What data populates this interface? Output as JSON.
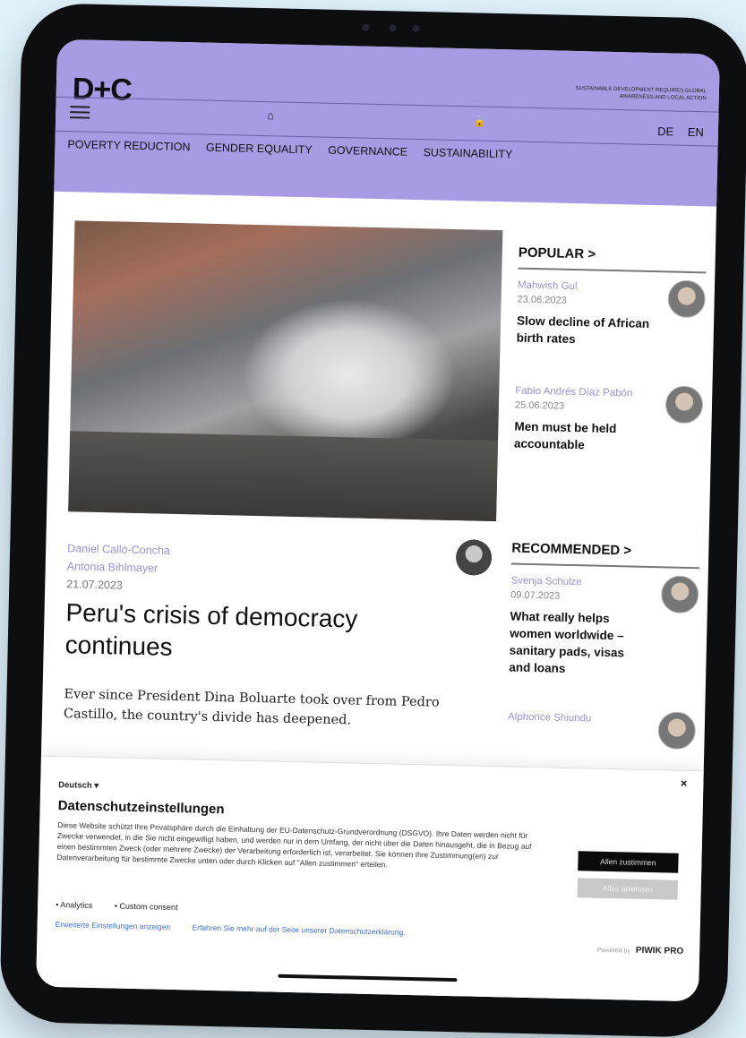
{
  "header": {
    "logo": "D+C",
    "tagline": "SUSTAINABLE DEVELOPMENT REQUIRES GLOBAL AWARENESS AND LOCAL ACTION",
    "languages": [
      "DE",
      "EN"
    ],
    "nav": [
      "POVERTY REDUCTION",
      "GENDER EQUALITY",
      "GOVERNANCE",
      "SUSTAINABILITY"
    ]
  },
  "article": {
    "authors": [
      "Daniel Callo-Concha",
      "Antonia Bihlmayer"
    ],
    "date": "21.07.2023",
    "title": "Peru's crisis of democracy continues",
    "teaser": "Ever since President Dina Boluarte took over from Pedro Castillo, the country's divide has deepened."
  },
  "popular": {
    "heading": "POPULAR >",
    "items": [
      {
        "author": "Mahwish Gul",
        "date": "23.06.2023",
        "title": "Slow decline of African birth rates"
      },
      {
        "author": "Fabio Andrés Díaz Pabón",
        "date": "25.06.2023",
        "title": "Men must be held accountable"
      }
    ]
  },
  "recommended": {
    "heading": "RECOMMENDED >",
    "items": [
      {
        "author": "Svenja Schulze",
        "date": "09.07.2023",
        "title": "What really helps women worldwide – sanitary pads, visas and loans"
      },
      {
        "author": "Alphonce Shiundu"
      }
    ]
  },
  "cookie": {
    "close": "×",
    "language": "Deutsch ▾",
    "title": "Datenschutzeinstellungen",
    "text": "Diese Website schützt Ihre Privatsphäre durch die Einhaltung der EU-Datenschutz-Grundverordnung (DSGVO). Ihre Daten werden nicht für Zwecke verwendet, in die Sie nicht eingewilligt haben, und werden nur in dem Umfang, der nicht über die Daten hinausgeht, die in Bezug auf einen bestimmten Zweck (oder mehrere Zwecke) der Verarbeitung erforderlich ist, verarbeitet. Sie können Ihre Zustimmung(en) zur Datenverarbeitung für bestimmte Zwecke unten oder durch Klicken auf \"Allen zustimmen\" erteilen.",
    "options": [
      "• Analytics",
      "• Custom consent"
    ],
    "link_settings": "Erweiterte Einstellungen anzeigen",
    "link_privacy": "Erfahren Sie mehr auf der Seite unserer Datenschutzerklärung.",
    "accept_label": "Allen zustimmen",
    "deny_label": "Alles ablehnen",
    "powered": "Powered by",
    "brand": "PIWIK PRO"
  }
}
